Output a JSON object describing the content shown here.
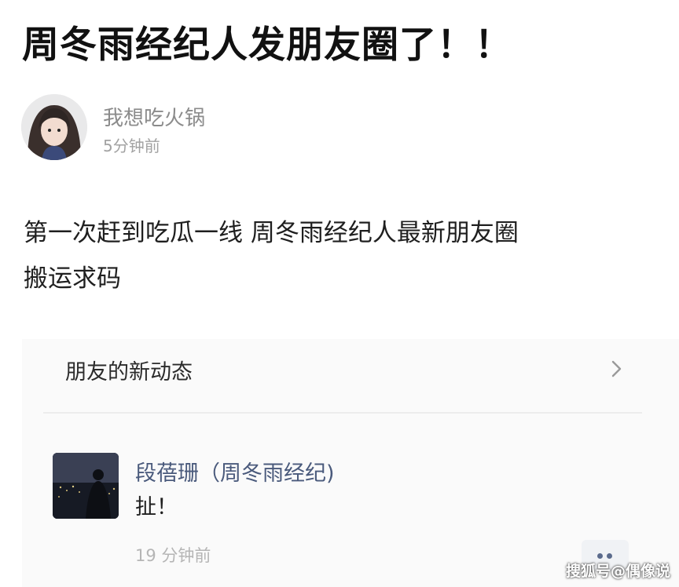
{
  "headline": "周冬雨经纪人发朋友圈了！！",
  "post": {
    "username": "我想吃火锅",
    "time": "5分钟前",
    "body_lines": [
      "第一次赶到吃瓜一线  周冬雨经纪人最新朋友圈",
      "搬运求码"
    ]
  },
  "moments": {
    "title": "朋友的新动态",
    "chevron_icon": "chevron-right-icon"
  },
  "comment": {
    "name": "段蓓珊（周冬雨经纪)",
    "text": "扯！",
    "time": "19 分钟前",
    "more_icon": "more-dots-icon"
  },
  "watermark": "搜狐号@偶像说",
  "colors": {
    "headline": "#111111",
    "username": "#8b8b8b",
    "link_name": "#4a5a7c",
    "panel_bg": "#fafafa"
  }
}
